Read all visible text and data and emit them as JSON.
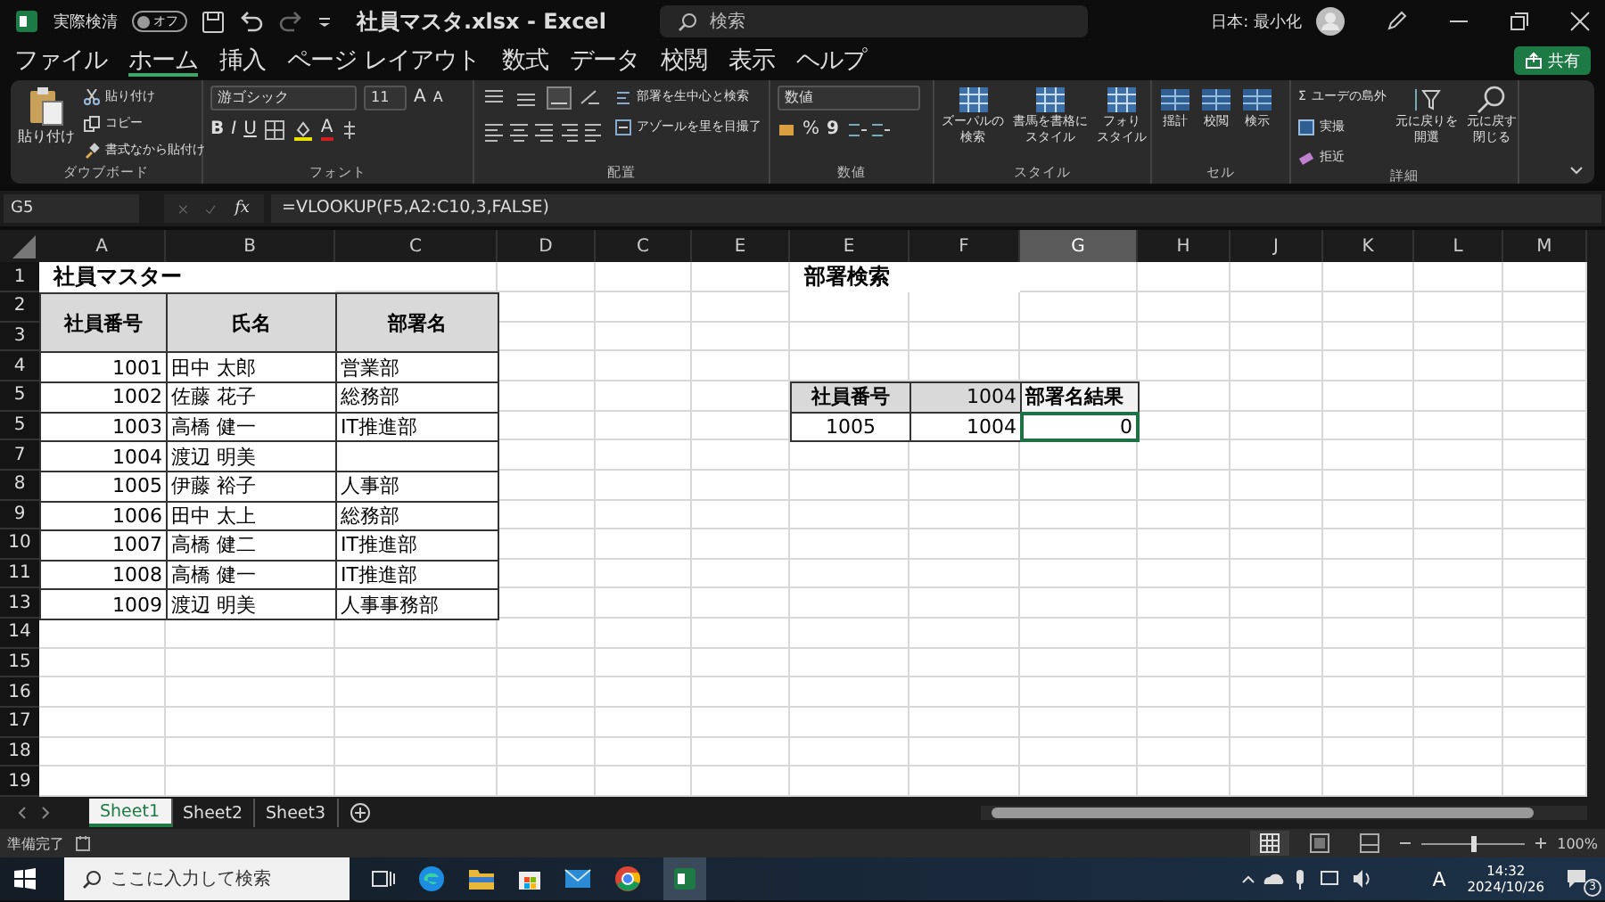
{
  "title_bar": {
    "autosave_label": "実際検清",
    "autosave": {
      "label": "オフ",
      "on": false
    },
    "title": "社員マスタ.xlsx - Excel",
    "search": {
      "placeholder": "検索"
    },
    "user": "日本: 最小化"
  },
  "share_button": "共有",
  "menu": [
    {
      "label": "ファイル",
      "selected": false
    },
    {
      "label": "ホーム",
      "selected": true
    },
    {
      "label": "挿入",
      "selected": false
    },
    {
      "label": "ページ レイアウト",
      "selected": false
    },
    {
      "label": "数式",
      "selected": false
    },
    {
      "label": "データ",
      "selected": false
    },
    {
      "label": "校閲",
      "selected": false
    },
    {
      "label": "表示",
      "selected": false
    },
    {
      "label": "ヘルプ",
      "selected": false
    }
  ],
  "ribbon": {
    "clipboard": {
      "paste": "貼り付け",
      "cut": "貼り付け",
      "copy": "コピー",
      "format_painter": "書式なから貼付け",
      "label": "ダウブボード"
    },
    "font": {
      "name": "游ゴシック",
      "size": "11",
      "grow": "A",
      "shrink": "A",
      "bold": "B",
      "italic": "I",
      "underline": "U",
      "font_color_button": "A",
      "label": "フォント"
    },
    "alignment": {
      "wrap": "部署を生中心と検索",
      "merge": "アゾールを里を目撮了",
      "label": "配置"
    },
    "number": {
      "format": "数値",
      "percent": "%",
      "comma": "9",
      "label": "数値"
    },
    "styles": {
      "items": [
        {
          "lines": [
            "ズーパルの",
            "検索"
          ]
        },
        {
          "lines": [
            "書馬を書格に",
            "スタイル"
          ]
        },
        {
          "lines": [
            "フォり",
            "スタイル"
          ]
        }
      ],
      "label": "スタイル"
    },
    "cells": {
      "items": [
        "揺計",
        "校閲",
        "検示"
      ],
      "label": "セル"
    },
    "editing": {
      "sum_sign": "Σ",
      "sum": "ユーデの島外",
      "fill": "実撮",
      "clear": "拒近",
      "sort": [
        "元に戻りを",
        "開選"
      ],
      "find": [
        "元に戻す",
        "閉じる"
      ],
      "label": "詳細"
    }
  },
  "formula_bar": {
    "name_box": "G5",
    "fx": "fx",
    "formula": "=VLOOKUP(F5,A2:C10,3,FALSE)"
  },
  "columns": [
    {
      "label": "A",
      "selected": false
    },
    {
      "label": "B",
      "selected": false
    },
    {
      "label": "C",
      "selected": false
    },
    {
      "label": "D",
      "selected": false
    },
    {
      "label": "C",
      "selected": false
    },
    {
      "label": "E",
      "selected": false
    },
    {
      "label": "E",
      "selected": false
    },
    {
      "label": "F",
      "selected": false
    },
    {
      "label": "G",
      "selected": true
    },
    {
      "label": "H",
      "selected": false
    },
    {
      "label": "J",
      "selected": false
    },
    {
      "label": "K",
      "selected": false
    },
    {
      "label": "L",
      "selected": false
    },
    {
      "label": "M",
      "selected": false
    }
  ],
  "rows": [
    {
      "label": "1",
      "cells": [
        {
          "text": "社員マスター",
          "kind": "title",
          "selected": false
        },
        null,
        null,
        null,
        null,
        null,
        {
          "text": "部署検索",
          "kind": "title",
          "selected": false
        }
      ]
    },
    {
      "label": "2",
      "cells": [
        {
          "text": "社員番号",
          "kind": "merged-header",
          "selected": false
        },
        {
          "text": "氏名",
          "kind": "merged-header",
          "selected": false
        },
        {
          "text": "部署名",
          "kind": "merged-header",
          "selected": false
        }
      ]
    },
    {
      "label": "3"
    },
    {
      "label": "4",
      "cells": [
        {
          "text": "1001",
          "kind": "number",
          "selected": false
        },
        {
          "text": "田中 太郎",
          "kind": "text",
          "selected": false
        },
        {
          "text": "営業部",
          "kind": "text",
          "selected": false
        }
      ]
    },
    {
      "label": "5",
      "cells": [
        {
          "text": "1002",
          "kind": "number",
          "selected": false
        },
        {
          "text": "佐藤 花子",
          "kind": "text",
          "selected": false
        },
        {
          "text": "総務部",
          "kind": "text",
          "selected": false
        },
        null,
        null,
        null,
        {
          "text": "社員番号",
          "kind": "header",
          "selected": false
        },
        {
          "text": "1004",
          "kind": "header-number",
          "selected": false
        },
        {
          "text": "部署名結果",
          "kind": "label",
          "selected": false
        }
      ]
    },
    {
      "label": "5",
      "cells": [
        {
          "text": "1003",
          "kind": "number",
          "selected": false
        },
        {
          "text": "高橋 健一",
          "kind": "text",
          "selected": false
        },
        {
          "text": "IT推進部",
          "kind": "text",
          "selected": false
        },
        null,
        null,
        null,
        {
          "text": "1005",
          "kind": "center",
          "selected": false
        },
        {
          "text": "1004",
          "kind": "number",
          "selected": false
        },
        {
          "text": "0",
          "kind": "number",
          "selected": true
        }
      ]
    },
    {
      "label": "7",
      "cells": [
        {
          "text": "1004",
          "kind": "number",
          "selected": false
        },
        {
          "text": "渡辺 明美",
          "kind": "text",
          "selected": false
        },
        {
          "kind": "text",
          "selected": false
        }
      ]
    },
    {
      "label": "8",
      "cells": [
        {
          "text": "1005",
          "kind": "number",
          "selected": false
        },
        {
          "text": "伊藤 裕子",
          "kind": "text",
          "selected": false
        },
        {
          "text": "人事部",
          "kind": "text",
          "selected": false
        }
      ]
    },
    {
      "label": "9",
      "cells": [
        {
          "text": "1006",
          "kind": "number",
          "selected": false
        },
        {
          "text": "田中 太上",
          "kind": "text",
          "selected": false
        },
        {
          "text": "総務部",
          "kind": "text",
          "selected": false
        }
      ]
    },
    {
      "label": "10",
      "cells": [
        {
          "text": "1007",
          "kind": "number",
          "selected": false
        },
        {
          "text": "高橋 健二",
          "kind": "text",
          "selected": false
        },
        {
          "text": "IT推進部",
          "kind": "text",
          "selected": false
        }
      ]
    },
    {
      "label": "11",
      "cells": [
        {
          "text": "1008",
          "kind": "number",
          "selected": false
        },
        {
          "text": "高橋 健一",
          "kind": "text",
          "selected": false
        },
        {
          "text": "IT推進部",
          "kind": "text",
          "selected": false
        }
      ]
    },
    {
      "label": "13",
      "cells": [
        {
          "text": "1009",
          "kind": "number",
          "selected": false
        },
        {
          "text": "渡辺 明美",
          "kind": "text",
          "selected": false
        },
        {
          "text": "人事事務部",
          "kind": "text",
          "selected": false
        }
      ]
    },
    {
      "label": "14"
    },
    {
      "label": "15"
    },
    {
      "label": "16"
    },
    {
      "label": "17"
    },
    {
      "label": "18"
    },
    {
      "label": "19"
    }
  ],
  "sheets": [
    {
      "label": "Sheet1",
      "selected": true
    },
    {
      "label": "Sheet2",
      "selected": false
    },
    {
      "label": "Sheet3",
      "selected": false
    }
  ],
  "status_bar": {
    "status": "準備完了",
    "zoom": {
      "level": 0.5
    },
    "zoom_label": "100%"
  },
  "taskbar": {
    "search": {
      "placeholder": "ここに入力して検索"
    },
    "ime": "A",
    "time": "14:32",
    "date": "2024/10/26",
    "notifications": "3"
  }
}
